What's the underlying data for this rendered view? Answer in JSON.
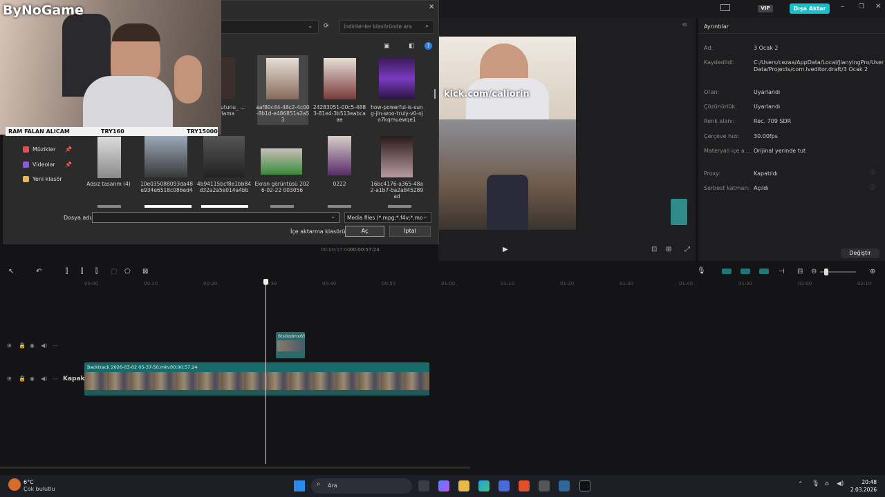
{
  "overlay": {
    "brand": "ByNoGame",
    "ticker_title": "RAM FALAN ALICAM",
    "ticker_price1": "TRY160",
    "ticker_price2": "TRY15000",
    "watermark": "kick.com/caliorin"
  },
  "topbar": {
    "vip_label": "VIP",
    "export_label": "Dışa Aktar"
  },
  "dialog": {
    "search_placeholder": "İndirilenler klasöründe ara",
    "nav": [
      {
        "label": "Müzikler",
        "color": "#e0505a"
      },
      {
        "label": "Videolar",
        "color": "#8a5ae0"
      },
      {
        "label": "Yeni klasör",
        "color": "#e8b84a"
      }
    ],
    "files_row1": [
      {
        "name": "...Boyutunu_\n...arlama"
      },
      {
        "name": "aaf80c44-48c2-4c00-8b1d-e486851a2a53"
      },
      {
        "name": "24283051-00c5-4883-81e4-3b513eabcaae"
      },
      {
        "name": "how-powerful-is-sung-jin-woo-truly-v0-ojo7kqmuewqe1"
      }
    ],
    "files_row2": [
      {
        "name": "Adsız tasarım (4)"
      },
      {
        "name": "10e035088093da48e934e6518c086ed4"
      },
      {
        "name": "4b94115bcf8e1bb84d32a2a5e014a4bb"
      },
      {
        "name": "Ekran görüntüsü 2026-02-22 003056"
      },
      {
        "name": "0222"
      },
      {
        "name": "16bc4176-a365-48a2-a1b7-ba2a845289ad"
      }
    ],
    "filename_label": "Dosya adı:",
    "filename_value": "",
    "filetype_value": "Media files (*.mpg;*.f4v;*.mov;",
    "import_folder_label": "İçe aktarma klasörü",
    "open_label": "Aç",
    "cancel_label": "İptal"
  },
  "preview": {
    "time_current": "00:00:37:00",
    "time_total": "00:00:57:24"
  },
  "details": {
    "header": "Ayrıntılar",
    "rows": [
      {
        "label": "Ad:",
        "value": "3 Ocak 2"
      },
      {
        "label": "Kaydedildi:",
        "value": "C:/Users/cezaa/AppData/Local/JianyingPro/User Data/Projects/com.lveditor.draft/3 Ocak 2"
      },
      {
        "label": "Oran:",
        "value": "Uyarlandı"
      },
      {
        "label": "Çözünürlük:",
        "value": "Uyarlandı"
      },
      {
        "label": "Renk alanı:",
        "value": "Rec. 709 SDR"
      },
      {
        "label": "Çerçeve hızı:",
        "value": "30.00fps"
      },
      {
        "label": "Materyali içe a...",
        "value": "Orijinal yerinde tut"
      },
      {
        "label": "Proxy:",
        "value": "Kapatıldı"
      },
      {
        "label": "Serbest katman:",
        "value": "Açıldı"
      }
    ],
    "change_label": "Değiştir"
  },
  "timeline": {
    "ticks": [
      "00:00",
      "00:10",
      "00:20",
      "00:30",
      "00:40",
      "00:50",
      "01:00",
      "01:10",
      "01:20",
      "01:30",
      "01:40",
      "01:50",
      "02:00",
      "02:10"
    ],
    "cover_label": "Kapak",
    "small_clip_label": "6ts0zdmx65",
    "main_clip_label": "Backtrack 2026-03-02 05-37-50.mkv",
    "main_clip_duration": "00:00:57.24",
    "playhead_fraction": 0.6379
  },
  "taskbar": {
    "weather_temp": "6°C",
    "weather_desc": "Çok bulutlu",
    "search_label": "Ara",
    "time": "20:48",
    "date": "2.03.2026"
  }
}
